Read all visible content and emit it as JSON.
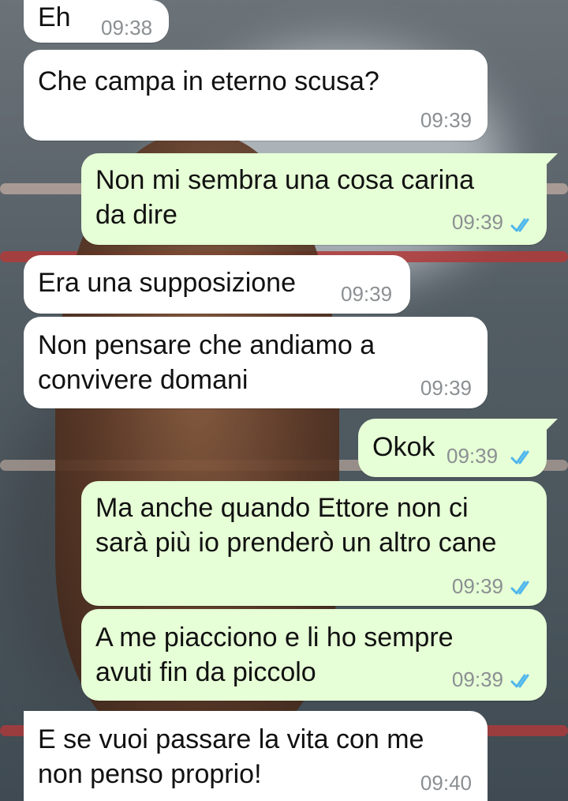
{
  "colors": {
    "incoming_bubble": "#ffffff",
    "outgoing_bubble": "#e6ffd6",
    "timestamp": "#8b8f92",
    "read_ticks": "#4fb6ec"
  },
  "messages": [
    {
      "direction": "incoming",
      "text": "Eh",
      "time": "09:38"
    },
    {
      "direction": "incoming",
      "text": "Che campa in eterno scusa?",
      "time": "09:39"
    },
    {
      "direction": "outgoing",
      "text": "Non mi sembra una cosa carina\nda dire",
      "time": "09:39",
      "status": "read-ticks-icon"
    },
    {
      "direction": "incoming",
      "text": "Era una supposizione",
      "time": "09:39"
    },
    {
      "direction": "incoming",
      "text": "Non pensare che andiamo a\nconvivere domani",
      "time": "09:39"
    },
    {
      "direction": "outgoing",
      "text": "Okok",
      "time": "09:39",
      "status": "read-ticks-icon"
    },
    {
      "direction": "outgoing",
      "text": "Ma anche quando Ettore non ci\nsarà più io prenderò un altro cane",
      "time": "09:39",
      "status": "read-ticks-icon"
    },
    {
      "direction": "outgoing",
      "text": "A me piacciono e li ho sempre\navuti fin da piccolo",
      "time": "09:39",
      "status": "read-ticks-icon"
    },
    {
      "direction": "incoming",
      "text": "E se vuoi passare la vita con me\nnon penso proprio!",
      "time": "09:40"
    }
  ]
}
